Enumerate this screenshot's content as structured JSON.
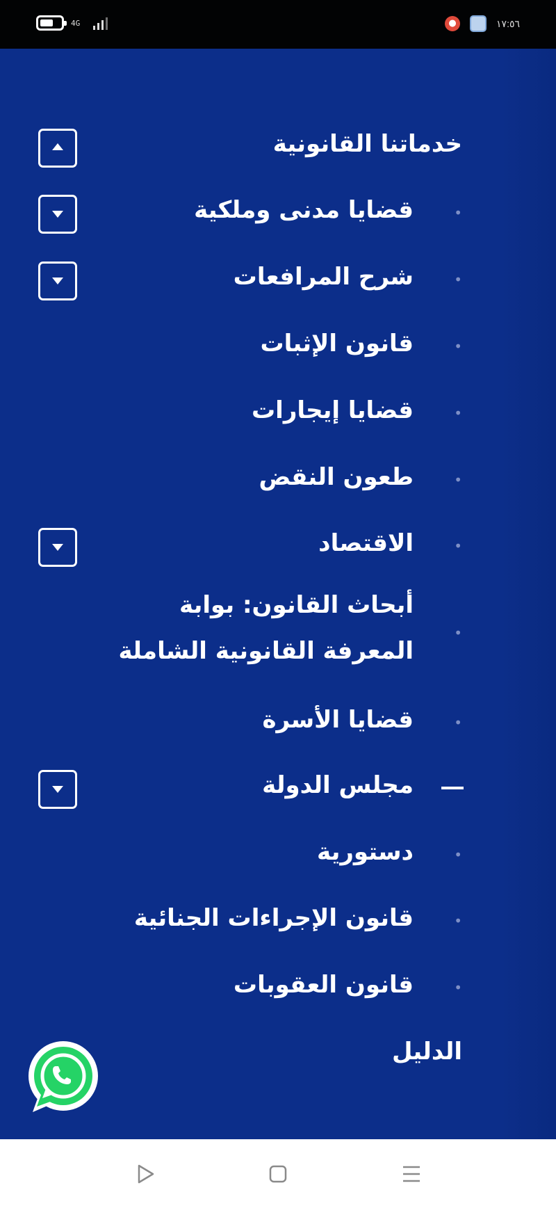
{
  "status_bar": {
    "network_label": "4G",
    "time": "١٧:٥٦",
    "icons": [
      "battery-icon",
      "network-icon",
      "signal-icon",
      "notification-icon",
      "app-icon"
    ]
  },
  "menu": {
    "top_item": {
      "label": "خدماتنا القانونية",
      "toggle": "collapse"
    },
    "sub_items": [
      {
        "label": "قضايا مدنى وملكية",
        "toggle": "expand"
      },
      {
        "label": "شرح المرافعات",
        "toggle": "expand"
      },
      {
        "label": "قانون الإثبات"
      },
      {
        "label": "قضايا إيجارات"
      },
      {
        "label": "طعون النقض"
      },
      {
        "label": "الاقتصاد",
        "toggle": "expand"
      },
      {
        "label_line1": "أبحاث القانون: بوابة",
        "label_line2": "المعرفة القانونية الشاملة"
      },
      {
        "label": "قضايا الأسرة"
      },
      {
        "label": "مجلس الدولة",
        "toggle": "expand",
        "marker": "dash"
      },
      {
        "label": "دستورية"
      },
      {
        "label": "قانون الإجراءات الجنائية"
      },
      {
        "label": "قانون العقوبات"
      }
    ],
    "bottom_item": {
      "label": "الدليل"
    }
  },
  "whatsapp": {
    "icon": "whatsapp-icon",
    "color": "#25d366"
  },
  "nav_bar": {
    "buttons": [
      "back-icon",
      "home-icon",
      "menu-icon"
    ]
  },
  "colors": {
    "background": "#0c2e8a",
    "text": "#ffffff",
    "status_bar": "#020304"
  }
}
